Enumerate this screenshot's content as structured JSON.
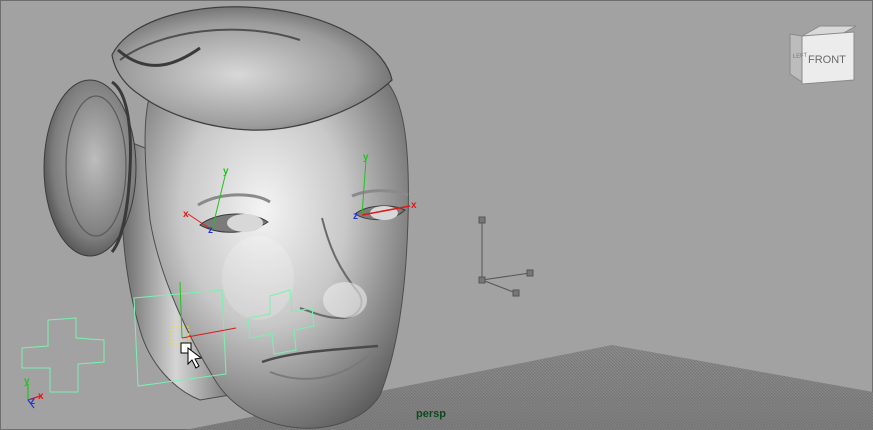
{
  "viewport": {
    "camera_name": "persp"
  },
  "view_cube": {
    "front_label": "FRONT",
    "left_label": "LEFT"
  },
  "locators": {
    "left_eye": {
      "x": "x",
      "y": "y",
      "z": "z"
    },
    "right_eye": {
      "x": "x",
      "y": "y",
      "z": "z"
    }
  },
  "corner_axis": {
    "x": "x",
    "y": "y",
    "z": "z"
  },
  "colors": {
    "background": "#a2a2a2",
    "control_curve": "#7cf0b0",
    "axis_x": "#e01818",
    "axis_y": "#21c21f",
    "axis_z": "#2236d8",
    "camera_label": "#0e4a1e"
  }
}
